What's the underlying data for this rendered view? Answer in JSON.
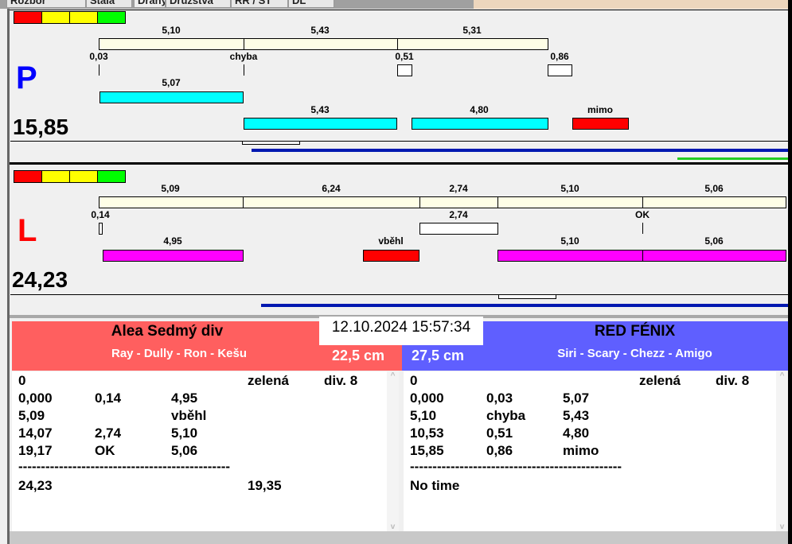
{
  "tabs": [
    "Rozbor",
    "Stala",
    "Dráhy",
    "Družstva",
    "RR / ST",
    "DL"
  ],
  "lane_p": {
    "letter": "P",
    "total": "15,85",
    "row1": [
      "5,10",
      "5,43",
      "5,31"
    ],
    "row2": [
      "0,03",
      "chyba",
      "0,51",
      "0,86"
    ],
    "row3": [
      "5,07"
    ],
    "row4": [
      "5,43",
      "4,80",
      "mimo"
    ]
  },
  "lane_l": {
    "letter": "L",
    "total": "24,23",
    "row1": [
      "5,09",
      "6,24",
      "2,74",
      "5,10",
      "5,06"
    ],
    "row2": [
      "0,14",
      "2,74",
      "OK"
    ],
    "row3": [
      "4,95",
      "vběhl",
      "5,10",
      "5,06"
    ]
  },
  "datetime": "12.10.2024 15:57:34",
  "left_team": {
    "name": "Alea Sedmý div",
    "members": "Ray - Dully - Ron - Kešu",
    "distance": "22,5 cm",
    "rows": [
      [
        "0",
        "",
        "",
        "zelená",
        "div. 8"
      ],
      [
        "0,000",
        "0,14",
        "4,95",
        "",
        ""
      ],
      [
        "5,09",
        "",
        "vběhl",
        "",
        ""
      ],
      [
        "14,07",
        "2,74",
        "5,10",
        "",
        ""
      ],
      [
        "19,17",
        "OK",
        "5,06",
        "",
        ""
      ]
    ],
    "separator": "-----------------------------------------------",
    "result": "24,23",
    "result2": "19,35"
  },
  "right_team": {
    "name": "RED FÉNIX",
    "members": "Siri - Scary - Chezz - Amigo",
    "distance": "27,5 cm",
    "rows": [
      [
        "0",
        "",
        "",
        "zelená",
        "div. 8"
      ],
      [
        "0,000",
        "0,03",
        "5,07",
        "",
        ""
      ],
      [
        "5,10",
        "chyba",
        "5,43",
        "",
        ""
      ],
      [
        "10,53",
        "0,51",
        "4,80",
        "",
        ""
      ],
      [
        "15,85",
        "0,86",
        "mimo",
        "",
        ""
      ]
    ],
    "separator": "-----------------------------------------------",
    "result": "No time",
    "result2": ""
  },
  "scroll": {
    "up": "^",
    "down": "v"
  },
  "colors": {
    "left": "#ff5f5f",
    "right": "#5f5fff",
    "p_letter": "#0000ff",
    "l_letter": "#ff0000"
  }
}
